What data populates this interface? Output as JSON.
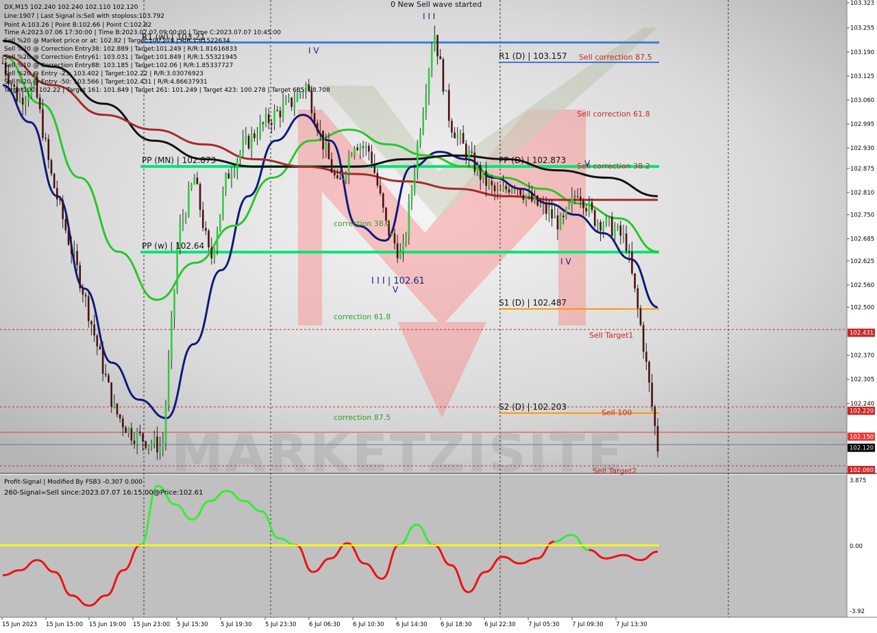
{
  "header": {
    "lines": [
      "DX,M15  102.240 102.240 102.110 102.120",
      "Line:1907 | Last Signal is:Sell with stoploss:103.792",
      "Point A:103.26 | Point B:102.66 | Point C:102.82",
      "Time A:2023.07.06 17:30:00 | Time B:2023.07.07 09:00:00 | Time C:2023.07.07 10:45:00",
      "Sell %20 @ Market price or at: 102.82 | Target:100.278 | R/R:1.81522634",
      "Sell %20 @ Correction Entry38: 102.889 | Target:101.249 | R/R:1.81616833",
      "Sell %20 @ Correction Entry61: 103.031 | Target:101.849 | R/R:1.55321945",
      "Sell %10 @ Correction Entry88: 103.185 | Target:102.06 | R/R:1.85337727",
      "Sell %20 @ Entry -23: 103.402 | Target:102.22 | R/R:3.03076923",
      "Sell %20 @ Entry -50: 103.566 | Target:102.431 | R/R:4.86637931",
      "Target100: 102.22 | Target 161: 101.849 | Target 261: 101.249 | Target 423: 100.278 | Target 685: 98.708"
    ],
    "top_label": "0 New Sell wave started"
  },
  "watermark": "MARKETZISITE",
  "price_axis": {
    "ticks": [
      "103.323",
      "103.255",
      "103.190",
      "103.125",
      "103.060",
      "102.995",
      "102.930",
      "102.875",
      "102.810",
      "102.750",
      "102.685",
      "102.625",
      "102.560",
      "102.500",
      "102.431",
      "102.370",
      "102.305",
      "102.240",
      "102.220",
      "102.150",
      "102.120",
      "102.060"
    ],
    "highlight": [
      {
        "label": "102.431",
        "color": "#c62828"
      },
      {
        "label": "102.220",
        "color": "#c62828"
      },
      {
        "label": "102.150",
        "color": "#e53935"
      },
      {
        "label": "102.120",
        "color": "#000000"
      },
      {
        "label": "102.060",
        "color": "#c62828"
      }
    ]
  },
  "levels": [
    {
      "label": "R1 (w) | 103.21",
      "color": "#3a7bd5"
    },
    {
      "label": "R1 (D) | 103.157",
      "color": "#3a7bd5"
    },
    {
      "label": "PP (MN) | 102.873",
      "color": "#00e676"
    },
    {
      "label": "PP (D) | 102.873",
      "color": "#00e676"
    },
    {
      "label": "PP (w) | 102.64",
      "color": "#00e676"
    },
    {
      "label": "S1 (D) | 102.487",
      "color": "#ff9800"
    },
    {
      "label": "S2 (D) | 102.203",
      "color": "#ff9800"
    }
  ],
  "annotations": [
    {
      "text": "Sell correction 87.5",
      "color": "#c62828"
    },
    {
      "text": "Sell correction 61.8",
      "color": "#c62828"
    },
    {
      "text": "Sell correction 38.2",
      "color": "#c62828"
    },
    {
      "text": "Sell Target1",
      "color": "#c62828"
    },
    {
      "text": "Sell 100",
      "color": "#c62828"
    },
    {
      "text": "Sell Target2",
      "color": "#c62828"
    },
    {
      "text": "correction 38.2",
      "color": "#2e9e2e"
    },
    {
      "text": "correction 61.8",
      "color": "#2e9e2e"
    },
    {
      "text": "correction 87.5",
      "color": "#2e9e2e"
    },
    {
      "text": "I I I | 102.61",
      "color": "#1a237e"
    },
    {
      "text": "I V",
      "color": "#1a237e"
    },
    {
      "text": "I I I",
      "color": "#1a237e"
    },
    {
      "text": "I V",
      "color": "#1a237e"
    },
    {
      "text": "V",
      "color": "#1a237e"
    },
    {
      "text": "V",
      "color": "#1a237e"
    }
  ],
  "indicator": {
    "title": "Profit-Signal | Modified By FSB3 -0.307 0.000",
    "signal": "260-Signal=Sell since:2023.07.07 16:15:00@Price:102.61",
    "ticks": [
      "3.875",
      "0.00",
      "-3.92"
    ]
  },
  "time_axis": [
    "15 Jun 2023",
    "15 Jun 15:00",
    "15 Jun 19:00",
    "15 Jun 23:00",
    "5 Jul 15:30",
    "5 Jul 19:30",
    "5 Jul 23:30",
    "6 Jul 06:30",
    "6 Jul 10:30",
    "6 Jul 14:30",
    "6 Jul 18:30",
    "6 Jul 22:30",
    "7 Jul 05:30",
    "7 Jul 09:30",
    "7 Jul 13:30"
  ],
  "chart_data": {
    "type": "line",
    "title": "DX,M15",
    "y_range": [
      102.06,
      103.323
    ],
    "series": [
      {
        "name": "price_close",
        "values": [
          103.16,
          103.06,
          103.1,
          102.86,
          102.7,
          102.55,
          102.38,
          102.22,
          102.16,
          102.14,
          102.12,
          102.7,
          102.85,
          102.62,
          102.85,
          102.93,
          102.98,
          103.02,
          103.05,
          103.1,
          102.95,
          102.82,
          102.95,
          102.92,
          102.72,
          102.63,
          102.95,
          103.25,
          103.0,
          102.92,
          102.85,
          102.8,
          102.84,
          102.79,
          102.76,
          102.72,
          102.82,
          102.74,
          102.72,
          102.68,
          102.43,
          102.12
        ],
        "color": "#111111"
      },
      {
        "name": "navy_ma",
        "values": [
          103.1,
          103.0,
          102.8,
          102.55,
          102.35,
          102.25,
          102.2,
          102.4,
          102.6,
          102.8,
          102.95,
          103.02,
          102.95,
          102.72,
          102.68,
          102.88,
          102.92,
          102.9,
          102.85,
          102.82,
          102.78,
          102.75,
          102.7,
          102.63,
          102.5
        ],
        "color": "#0d1a7a"
      },
      {
        "name": "green_ma",
        "values": [
          103.18,
          103.05,
          102.85,
          102.65,
          102.52,
          102.62,
          102.72,
          102.85,
          102.95,
          102.98,
          102.94,
          102.91,
          102.88,
          102.85,
          102.82,
          102.78,
          102.74,
          102.65
        ],
        "color": "#29c629"
      },
      {
        "name": "black_ma",
        "values": [
          103.22,
          103.15,
          103.05,
          102.95,
          102.9,
          102.88,
          102.88,
          102.88,
          102.9,
          102.91,
          102.9,
          102.87,
          102.85,
          102.8
        ],
        "color": "#111111"
      },
      {
        "name": "brown_ma",
        "values": [
          103.18,
          103.1,
          103.02,
          102.98,
          102.94,
          102.9,
          102.88,
          102.86,
          102.84,
          102.82,
          102.8,
          102.79,
          102.79,
          102.79
        ],
        "color": "#a52a2a"
      }
    ],
    "oscillator": {
      "name": "Profit-Signal",
      "range": [
        -3.92,
        3.875
      ],
      "values": [
        -1.8,
        -1.5,
        -0.9,
        -1.6,
        -3.0,
        -3.6,
        -3.0,
        -1.5,
        0.0,
        3.5,
        2.4,
        1.5,
        2.6,
        3.2,
        2.6,
        2.0,
        0.4,
        0.0,
        -1.6,
        -0.8,
        0.1,
        -1.1,
        -2.0,
        0.0,
        1.2,
        0.0,
        -1.2,
        -2.8,
        -1.6,
        -0.7,
        -1.1,
        -0.8,
        0.2,
        0.6,
        -0.3,
        -0.8,
        -0.6,
        -0.9,
        -0.4
      ]
    }
  }
}
